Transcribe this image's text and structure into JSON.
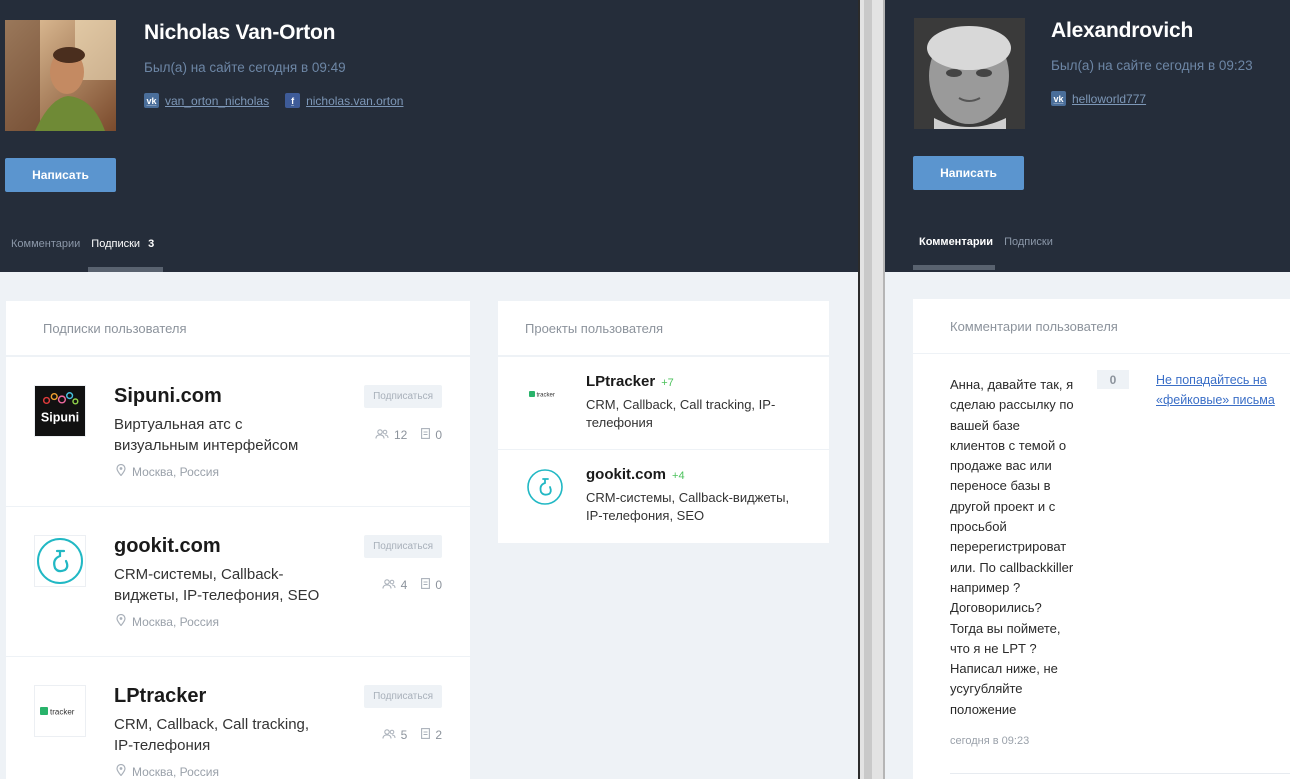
{
  "left": {
    "user": {
      "name": "Nicholas Van-Orton",
      "seen": "Был(а) на сайте сегодня в 09:49",
      "vk": "van_orton_nicholas",
      "fb": "nicholas.van.orton"
    },
    "write_button": "Написать",
    "tabs": {
      "comments": "Комментарии",
      "subscriptions": "Подписки",
      "subscriptions_count": "3"
    },
    "subscriptions_card": {
      "title": "Подписки пользователя",
      "items": [
        {
          "name": "Sipuni.com",
          "desc": "Виртуальная атс с визуальным интерфейсом",
          "location": "Москва, Россия",
          "button": "Подписаться",
          "followers": "12",
          "docs": "0"
        },
        {
          "name": "gookit.com",
          "desc": "CRM-системы, Callback-виджеты, IP-телефония, SEO",
          "location": "Москва, Россия",
          "button": "Подписаться",
          "followers": "4",
          "docs": "0"
        },
        {
          "name": "LPtracker",
          "desc": "CRM, Callback, Call tracking, IP-телефония",
          "location": "Москва, Россия",
          "button": "Подписаться",
          "followers": "5",
          "docs": "2"
        }
      ]
    },
    "projects_card": {
      "title": "Проекты пользователя",
      "items": [
        {
          "name": "LPtracker",
          "plus": "+7",
          "desc": "CRM, Callback, Call tracking, IP-телефония"
        },
        {
          "name": "gookit.com",
          "plus": "+4",
          "desc": "CRM-системы, Callback-виджеты, IP-телефония, SEO"
        }
      ]
    },
    "logos": {
      "sipuni": "Sipuni",
      "tracker": "tracker"
    }
  },
  "right": {
    "user": {
      "name": "Alexandrovich",
      "seen": "Был(а) на сайте сегодня в 09:23",
      "vk": "helloworld777"
    },
    "write_button": "Написать",
    "tabs": {
      "comments": "Комментарии",
      "subscriptions": "Подписки"
    },
    "comments_card": {
      "title": "Комментарии пользователя",
      "comment": {
        "text": "Анна, давайте так, я сделаю рассылку по вашей базе клиентов с темой о продаже вас или переносе базы в другой проект и с просьбой перерегистрироват или. По callbackkiller например ? Договорились? Тогда вы поймете, что я не LPT ? Написал ниже, не усугубляйте положение",
        "time": "сегодня в 09:23",
        "votes": "0",
        "link": "Не попадайтесь на «фейковые» письма"
      }
    }
  },
  "colors": {
    "header_bg": "#252d3a",
    "page_bg": "#eef2f6",
    "button": "#5b95cf",
    "link": "#3b6fc7",
    "plus": "#4cc25c"
  }
}
